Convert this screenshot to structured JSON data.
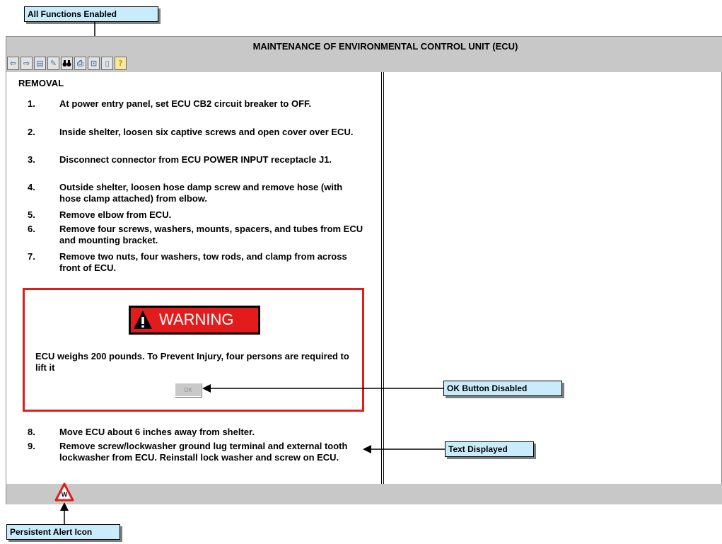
{
  "annotations": {
    "all_functions": "All Functions Enabled",
    "ok_disabled": "OK Button Disabled",
    "text_displayed": "Text Displayed",
    "persistent_alert": "Persistent Alert Icon"
  },
  "window": {
    "title": "MAINTENANCE OF ENVIRONMENTAL CONTROL UNIT (ECU)"
  },
  "toolbar": {
    "buttons": [
      {
        "name": "back-arrow-icon",
        "glyph": "⇦"
      },
      {
        "name": "forward-arrow-icon",
        "glyph": "⇨"
      },
      {
        "name": "save-icon",
        "glyph": "▤"
      },
      {
        "name": "annotate-icon",
        "glyph": "✎"
      },
      {
        "name": "find-binoculars-icon",
        "glyph": "👓"
      },
      {
        "name": "print-icon",
        "glyph": "⎙"
      },
      {
        "name": "bookmark-icon",
        "glyph": "⊡"
      },
      {
        "name": "exit-icon",
        "glyph": "▯"
      },
      {
        "name": "help-icon",
        "glyph": "?"
      }
    ]
  },
  "content": {
    "heading": "REMOVAL",
    "steps_before": [
      {
        "num": "1.",
        "text": "At power entry panel, set ECU CB2 circuit breaker to OFF."
      },
      {
        "num": "2.",
        "text": "Inside shelter, loosen six captive screws and open cover over ECU."
      },
      {
        "num": "3.",
        "text": "Disconnect connector from ECU POWER INPUT receptacle J1."
      },
      {
        "num": "4.",
        "text": "Outside shelter, loosen hose damp screw and remove hose (with hose clamp attached) from elbow."
      },
      {
        "num": "5.",
        "text": "Remove elbow from ECU."
      },
      {
        "num": "6.",
        "text": "Remove four screws, washers, mounts, spacers, and tubes from ECU and mounting bracket."
      },
      {
        "num": "7.",
        "text": "Remove two nuts, four washers, tow rods, and clamp from across front of ECU."
      }
    ],
    "warning": {
      "label": "WARNING",
      "text": "ECU weighs 200 pounds. To Prevent Injury, four persons are required to lift it",
      "ok_label": "OK"
    },
    "steps_after": [
      {
        "num": "8.",
        "text": "Move ECU about 6 inches away from shelter."
      },
      {
        "num": "9.",
        "text": "Remove screw/lockwasher ground lug terminal and external tooth lockwasher from ECU. Reinstall lock washer and screw on ECU."
      }
    ]
  },
  "status": {
    "alert_letter": "W"
  },
  "colors": {
    "accent_red": "#e21c1c",
    "callout_bg": "#c9ecfb",
    "chrome_gray": "#c8c8c8"
  }
}
